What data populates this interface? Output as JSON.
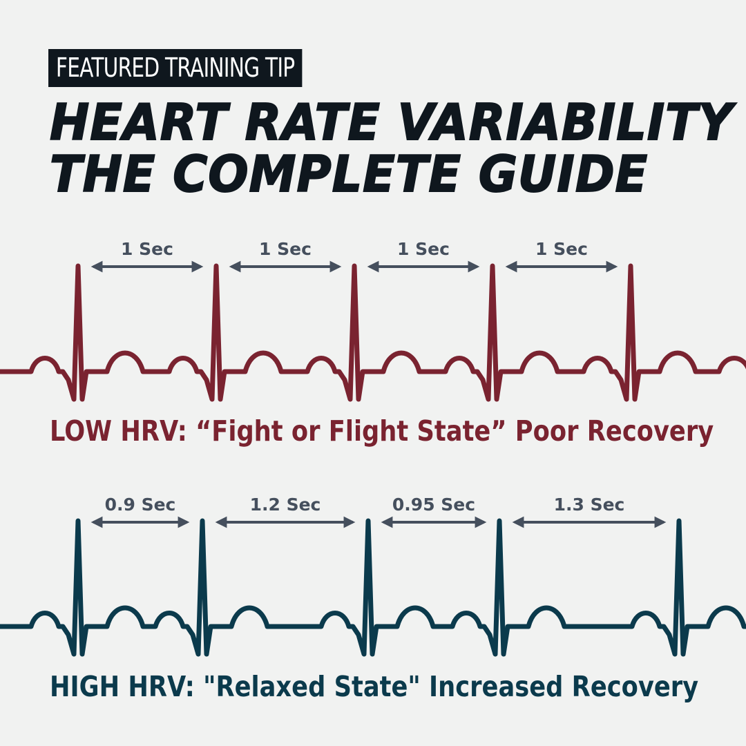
{
  "badge": "FEATURED TRAINING TIP",
  "title_line1": "HEART RATE VARIABILITY",
  "title_line2": "THE COMPLETE GUIDE",
  "colors": {
    "background": "#f1f2f1",
    "dark": "#0f171e",
    "low_hrv": "#7a2330",
    "high_hrv": "#0b3a4c",
    "arrow": "#454f5d"
  },
  "low_hrv": {
    "caption": "LOW HRV: “Fight or Flight State” Poor Recovery",
    "intervals": [
      "1 Sec",
      "1 Sec",
      "1 Sec",
      "1 Sec"
    ]
  },
  "high_hrv": {
    "caption": "HIGH HRV: \"Relaxed State\" Increased Recovery",
    "intervals": [
      "0.9 Sec",
      "1.2 Sec",
      "0.95 Sec",
      "1.3 Sec"
    ]
  }
}
